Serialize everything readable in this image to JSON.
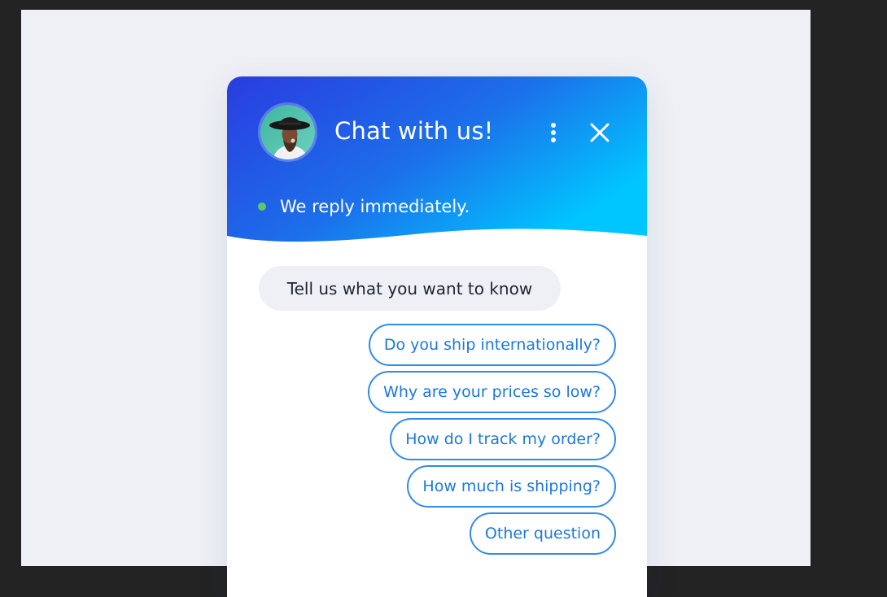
{
  "header": {
    "title": "Chat with us!",
    "status_text": "We reply immediately.",
    "status_color": "#5cc96a",
    "gradient": [
      "#2a3ce0",
      "#00c6ff"
    ]
  },
  "icons": {
    "menu": "vertical-dots-icon",
    "close": "close-icon"
  },
  "messages": {
    "bot": "Tell us what you want to know"
  },
  "options": [
    "Do you ship internationally?",
    "Why are your prices so low?",
    "How do I track my order?",
    "How much is shipping?",
    "Other question"
  ],
  "colors": {
    "accent": "#2f8ce8",
    "option_text": "#1a78dd",
    "bubble_bg": "#eef0f5",
    "page_bg": "#eef0f5",
    "frame_bg": "#232323"
  }
}
